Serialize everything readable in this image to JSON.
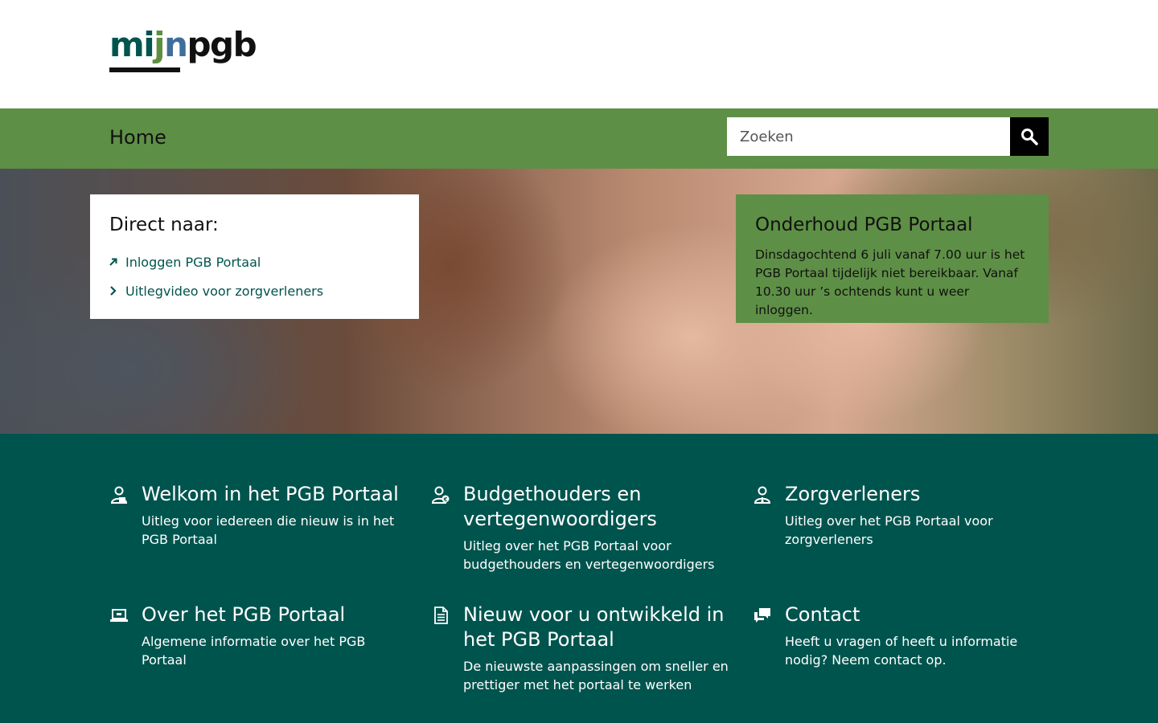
{
  "header": {
    "logo": {
      "part1": "mi",
      "part2": "j",
      "part3": "n",
      "part4": "pgb"
    }
  },
  "nav": {
    "home_label": "Home",
    "search_placeholder": "Zoeken"
  },
  "direct": {
    "title": "Direct naar:",
    "links": [
      {
        "label": "Inloggen PGB Portaal",
        "icon": "external-arrow-icon"
      },
      {
        "label": "Uitlegvideo voor zorgverleners",
        "icon": "chevron-right-icon"
      }
    ]
  },
  "notice": {
    "title": "Onderhoud PGB Portaal",
    "text": "Dinsdagochtend 6 juli vanaf 7.00 uur is het PGB Portaal tijdelijk niet bereikbaar. Vanaf 10.30 uur ’s ochtends kunt u weer inloggen."
  },
  "tiles": [
    {
      "title": "Welkom in het PGB Portaal",
      "desc": "Uitleg voor iedereen die nieuw is in het PGB Portaal",
      "icon": "user-welcome-icon"
    },
    {
      "title": "Budgethouders en vertegenwoordigers",
      "desc": "Uitleg over het PGB Portaal voor budgethouders en vertegenwoordigers",
      "icon": "user-budget-icon"
    },
    {
      "title": "Zorgverleners",
      "desc": "Uitleg over het PGB Portaal voor zorgverleners",
      "icon": "caregiver-icon"
    },
    {
      "title": "Over het PGB Portaal",
      "desc": "Algemene informatie over het PGB Portaal",
      "icon": "laptop-icon"
    },
    {
      "title": "Nieuw voor u ontwikkeld in het PGB Portaal",
      "desc": "De nieuwste aanpassingen om sneller en prettiger met het portaal te werken",
      "icon": "document-icon"
    },
    {
      "title": "Contact",
      "desc": "Heeft u vragen of heeft u informatie nodig? Neem contact op.",
      "icon": "chat-icon"
    }
  ],
  "colors": {
    "green": "#5e8f46",
    "teal": "#00544e"
  }
}
